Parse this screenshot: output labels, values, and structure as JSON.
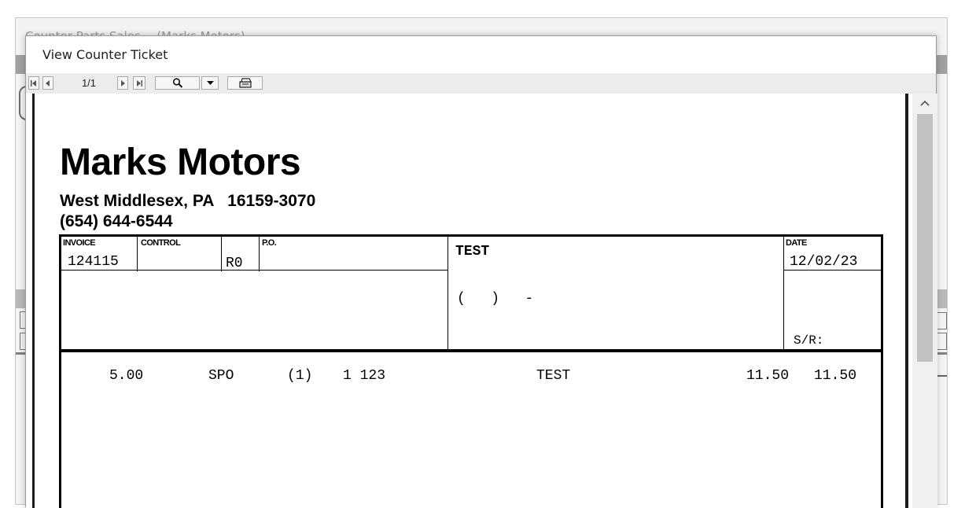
{
  "parent_window": {
    "title": "Counter Parts Sales -- (Marks Motors)"
  },
  "dialog": {
    "title": "View Counter Ticket"
  },
  "toolbar": {
    "page_indicator": "1/1",
    "icons": [
      "first-page-icon",
      "prev-page-icon",
      "next-page-icon",
      "last-page-icon",
      "zoom-icon",
      "dropdown-arrow-icon",
      "print-icon"
    ]
  },
  "ticket": {
    "company": "Marks Motors",
    "address": "West Middlesex, PA   16159-3070",
    "phone": "(654) 644-6544",
    "labels": {
      "invoice": "INVOICE",
      "control": "CONTROL",
      "po": "P.O.",
      "date": "DATE",
      "sr": "S/R:"
    },
    "invoice": "124115",
    "control": "",
    "code": "R0",
    "po": "",
    "customer_name": "TEST",
    "customer_phone": "(   )   -",
    "date": "12/02/23",
    "lines": [
      {
        "qty": "5.00",
        "type": "SPO",
        "group": "(1)",
        "part": "1 123",
        "description": "TEST",
        "price": "11.50",
        "amount": "11.50"
      }
    ]
  }
}
